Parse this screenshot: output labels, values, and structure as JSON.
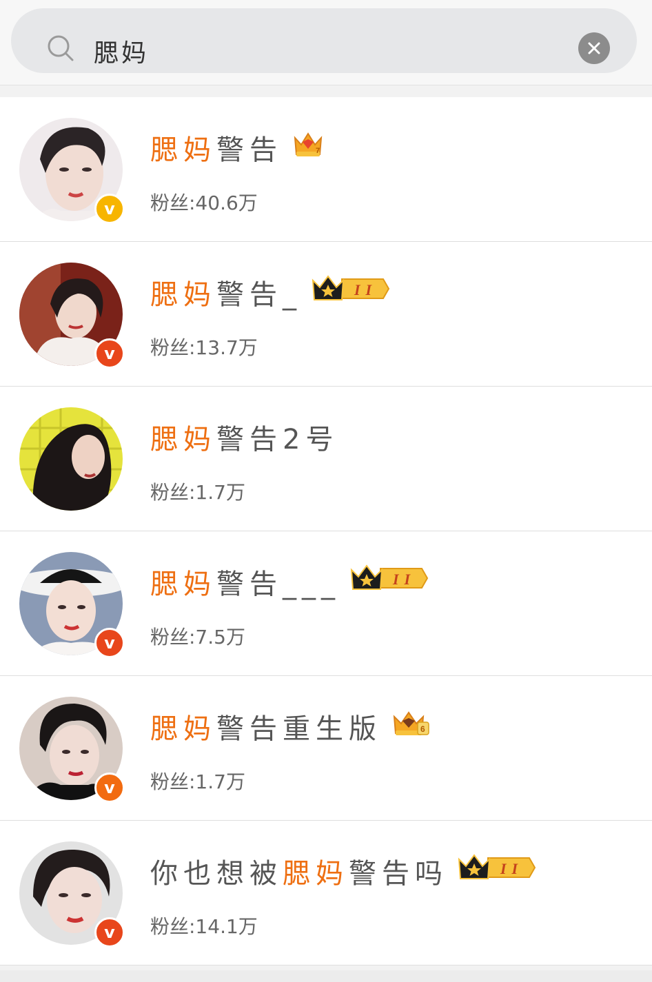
{
  "search": {
    "query": "腮妈"
  },
  "results": [
    {
      "name_pre": "",
      "name_hl": "腮妈",
      "name_post": "警告",
      "badge": "gold-crown-7-icon",
      "verified": "yellow",
      "fans_label": "粉丝:40.6万",
      "avatar_bg": "#e9e4e6"
    },
    {
      "name_pre": "",
      "name_hl": "腮妈",
      "name_post": "警告_",
      "badge": "black-crown-II-icon",
      "verified": "red",
      "fans_label": "粉丝:13.7万",
      "avatar_bg": "#8c2a22"
    },
    {
      "name_pre": "",
      "name_hl": "腮妈",
      "name_post": "警告2号",
      "badge": "",
      "verified": "",
      "fans_label": "粉丝:1.7万",
      "avatar_bg": "#e8e64a"
    },
    {
      "name_pre": "",
      "name_hl": "腮妈",
      "name_post": "警告___",
      "badge": "black-crown-II-icon",
      "verified": "red",
      "fans_label": "粉丝:7.5万",
      "avatar_bg": "#6b7f9e"
    },
    {
      "name_pre": "",
      "name_hl": "腮妈",
      "name_post": "警告重生版",
      "badge": "gold-crown-6-icon",
      "verified": "orange",
      "fans_label": "粉丝:1.7万",
      "avatar_bg": "#d7c9c2"
    },
    {
      "name_pre": "你也想被",
      "name_hl": "腮妈",
      "name_post": "警告吗",
      "badge": "black-crown-II-icon",
      "verified": "red",
      "fans_label": "粉丝:14.1万",
      "avatar_bg": "#dcdcdc"
    }
  ],
  "colors": {
    "highlight": "#ee6f12",
    "verified_yellow": "#f7b500",
    "verified_red": "#e8461b",
    "verified_orange": "#f26b10"
  }
}
